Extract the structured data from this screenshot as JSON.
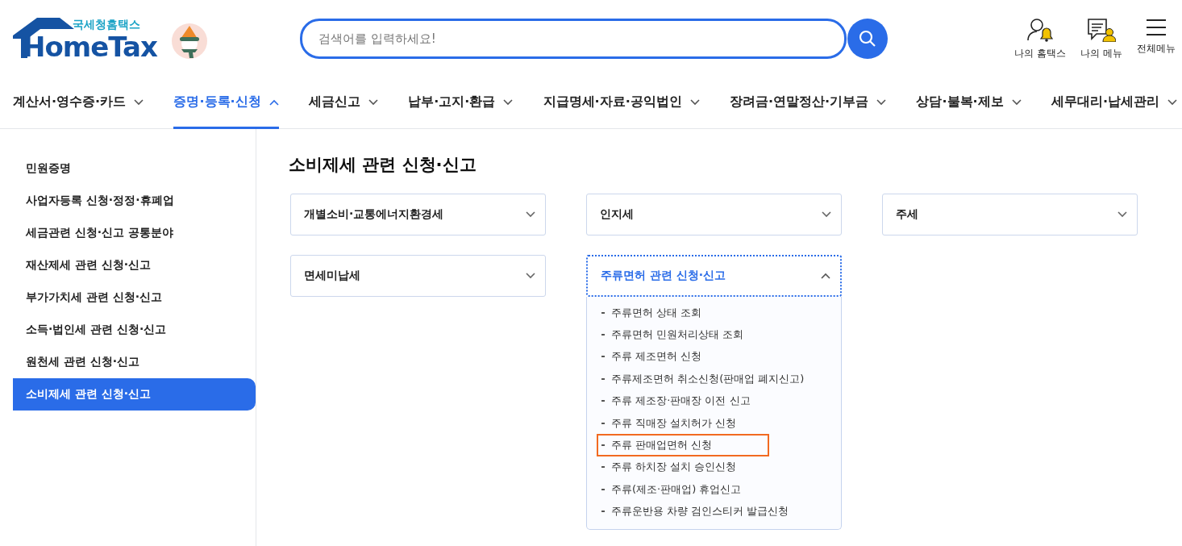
{
  "header": {
    "logo": {
      "subtitle": "국세청홈택스",
      "title": "HomeTax"
    },
    "search": {
      "placeholder": "검색어를 입력하세요!"
    },
    "quick_links": [
      {
        "label": "나의 홈택스",
        "kind": "user-bell"
      },
      {
        "label": "나의 메뉴",
        "kind": "note-person"
      },
      {
        "label": "전체메뉴",
        "kind": "hamburger"
      }
    ]
  },
  "nav": [
    {
      "label": "계산서·영수증·카드",
      "selected": false
    },
    {
      "label": "증명·등록·신청",
      "selected": true
    },
    {
      "label": "세금신고",
      "selected": false
    },
    {
      "label": "납부·고지·환급",
      "selected": false
    },
    {
      "label": "지급명세·자료·공익법인",
      "selected": false
    },
    {
      "label": "장려금·연말정산·기부금",
      "selected": false
    },
    {
      "label": "상담·불복·제보",
      "selected": false
    },
    {
      "label": "세무대리·납세관리",
      "selected": false
    }
  ],
  "sidebar": {
    "items": [
      {
        "label": "민원증명",
        "selected": false
      },
      {
        "label": "사업자등록 신청·정정·휴폐업",
        "selected": false
      },
      {
        "label": "세금관련 신청·신고 공통분야",
        "selected": false
      },
      {
        "label": "재산제세 관련 신청·신고",
        "selected": false
      },
      {
        "label": "부가가치세 관련 신청·신고",
        "selected": false
      },
      {
        "label": "소득·법인세 관련 신청·신고",
        "selected": false
      },
      {
        "label": "원천세 관련 신청·신고",
        "selected": false
      },
      {
        "label": "소비제세 관련 신청·신고",
        "selected": true
      }
    ]
  },
  "content": {
    "title": "소비제세 관련 신청·신고",
    "cards": [
      {
        "label": "개별소비·교통에너지환경세",
        "expanded": false
      },
      {
        "label": "인지세",
        "expanded": false
      },
      {
        "label": "주세",
        "expanded": false
      },
      {
        "label": "면세미납세",
        "expanded": false
      },
      {
        "label": "주류면허 관련 신청·신고",
        "expanded": true,
        "items": [
          {
            "label": "주류면허 상태 조회",
            "highlighted": false
          },
          {
            "label": "주류면허 민원처리상태 조회",
            "highlighted": false
          },
          {
            "label": "주류 제조면허 신청",
            "highlighted": false
          },
          {
            "label": "주류제조면허 취소신청(판매업 폐지신고)",
            "highlighted": false
          },
          {
            "label": "주류 제조장·판매장 이전 신고",
            "highlighted": false
          },
          {
            "label": "주류 직매장 설치허가 신청",
            "highlighted": false
          },
          {
            "label": "주류 판매업면허 신청",
            "highlighted": true
          },
          {
            "label": "주류 하치장 설치 승인신청",
            "highlighted": false
          },
          {
            "label": "주류(제조·판매업) 휴업신고",
            "highlighted": false
          },
          {
            "label": "주류운반용 차량 검인스티커 발급신청",
            "highlighted": false
          }
        ]
      }
    ]
  }
}
